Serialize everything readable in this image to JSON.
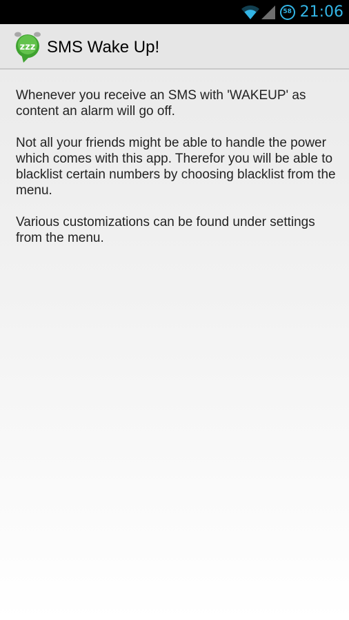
{
  "status_bar": {
    "time": "21:06",
    "battery_level": "58",
    "icons": [
      "wifi-icon",
      "signal-icon",
      "battery-icon"
    ],
    "accent_color": "#33b5e5"
  },
  "action_bar": {
    "title": "SMS Wake Up!",
    "icon_text": "zzz",
    "icon": "app-icon",
    "icon_color": "#3fa230"
  },
  "content": {
    "paragraphs": [
      "Whenever you receive an SMS with 'WAKEUP' as content an alarm will go off.",
      "Not all your friends might be able to handle the power which comes with this app. Therefor you will be able to blacklist certain numbers by choosing blacklist from the menu.",
      "Various customizations can be found under settings from the menu."
    ]
  }
}
